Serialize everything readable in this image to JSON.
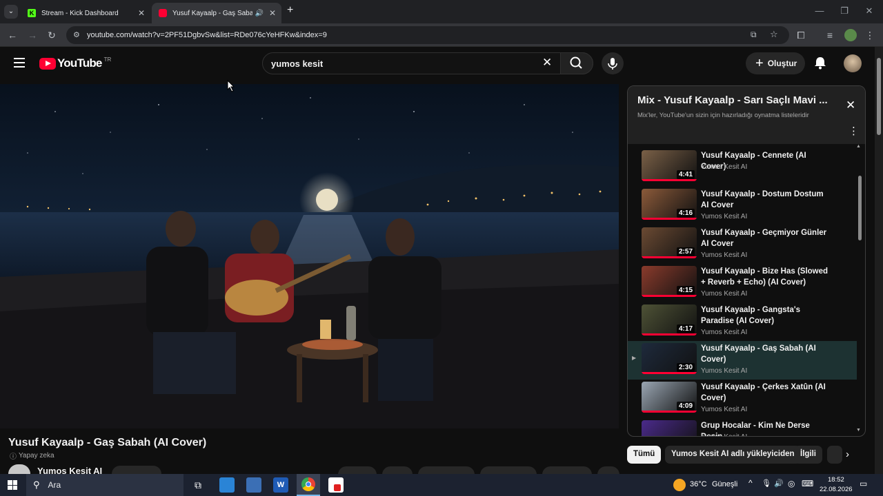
{
  "browser": {
    "tabs": [
      {
        "title": "Stream - Kick Dashboard",
        "favicon_color": "#53fc18"
      },
      {
        "title": "Yusuf Kayaalp - Gaş Sabah",
        "favicon_color": "#ff0033"
      }
    ],
    "url": "youtube.com/watch?v=2PF51DgbvSw&list=RDe076cYeHFKw&index=9"
  },
  "youtube": {
    "logo_text": "YouTube",
    "region": "TR",
    "search_value": "yumos kesit",
    "create_label": "Oluştur"
  },
  "video": {
    "title": "Yusuf Kayaalp - Gaş Sabah (AI Cover)",
    "badge": "Yapay zeka",
    "channel": "Yumos Kesit AI"
  },
  "playlist": {
    "title": "Mix - Yusuf Kayaalp - Sarı Saçlı Mavi ...",
    "subtitle": "Mix'ler, YouTube'un sizin için hazırladığı oynatma listeleridir",
    "items": [
      {
        "title": "Yusuf Kayaalp - Cennete (AI Cover)",
        "channel": "Yumos Kesit AI",
        "duration": "4:41",
        "color": "#7a6047"
      },
      {
        "title": "Yusuf Kayaalp - Dostum Dostum AI Cover",
        "channel": "Yumos Kesit AI",
        "duration": "4:16",
        "color": "#8b5a3a"
      },
      {
        "title": "Yusuf Kayaalp - Geçmiyor Günler AI Cover",
        "channel": "Yumos Kesit AI",
        "duration": "2:57",
        "color": "#6b4a33"
      },
      {
        "title": "Yusuf Kayaalp - Bize Has (Slowed + Reverb + Echo) (AI Cover)",
        "channel": "Yumos Kesit AI",
        "duration": "4:15",
        "color": "#8a3b2c"
      },
      {
        "title": "Yusuf Kayaalp - Gangsta's Paradise (AI Cover)",
        "channel": "Yumos Kesit AI",
        "duration": "4:17",
        "color": "#4e5236"
      },
      {
        "title": "Yusuf Kayaalp - Gaş Sabah (AI Cover)",
        "channel": "Yumos Kesit AI",
        "duration": "2:30",
        "color": "#1e2a3c",
        "active": true
      },
      {
        "title": "Yusuf Kayaalp - Çerkes Xatûn (AI Cover)",
        "channel": "Yumos Kesit AI",
        "duration": "4:09",
        "color": "#9aa6b3"
      },
      {
        "title": "Grup Hocalar - Kim Ne Derse Desin",
        "channel": "Yumos Kesit AI",
        "duration": "",
        "color": "#4a2a8a"
      }
    ]
  },
  "chips": [
    "Tümü",
    "Yumos Kesit AI adlı yükleyiciden",
    "İlgili"
  ],
  "taskbar": {
    "search_placeholder": "Ara",
    "weather": "36°C",
    "weather_text": "Güneşli",
    "time": "18:52",
    "date": "22.08.2026"
  },
  "colors": {
    "yt_red": "#ff0033",
    "active_row": "#1d3232"
  }
}
